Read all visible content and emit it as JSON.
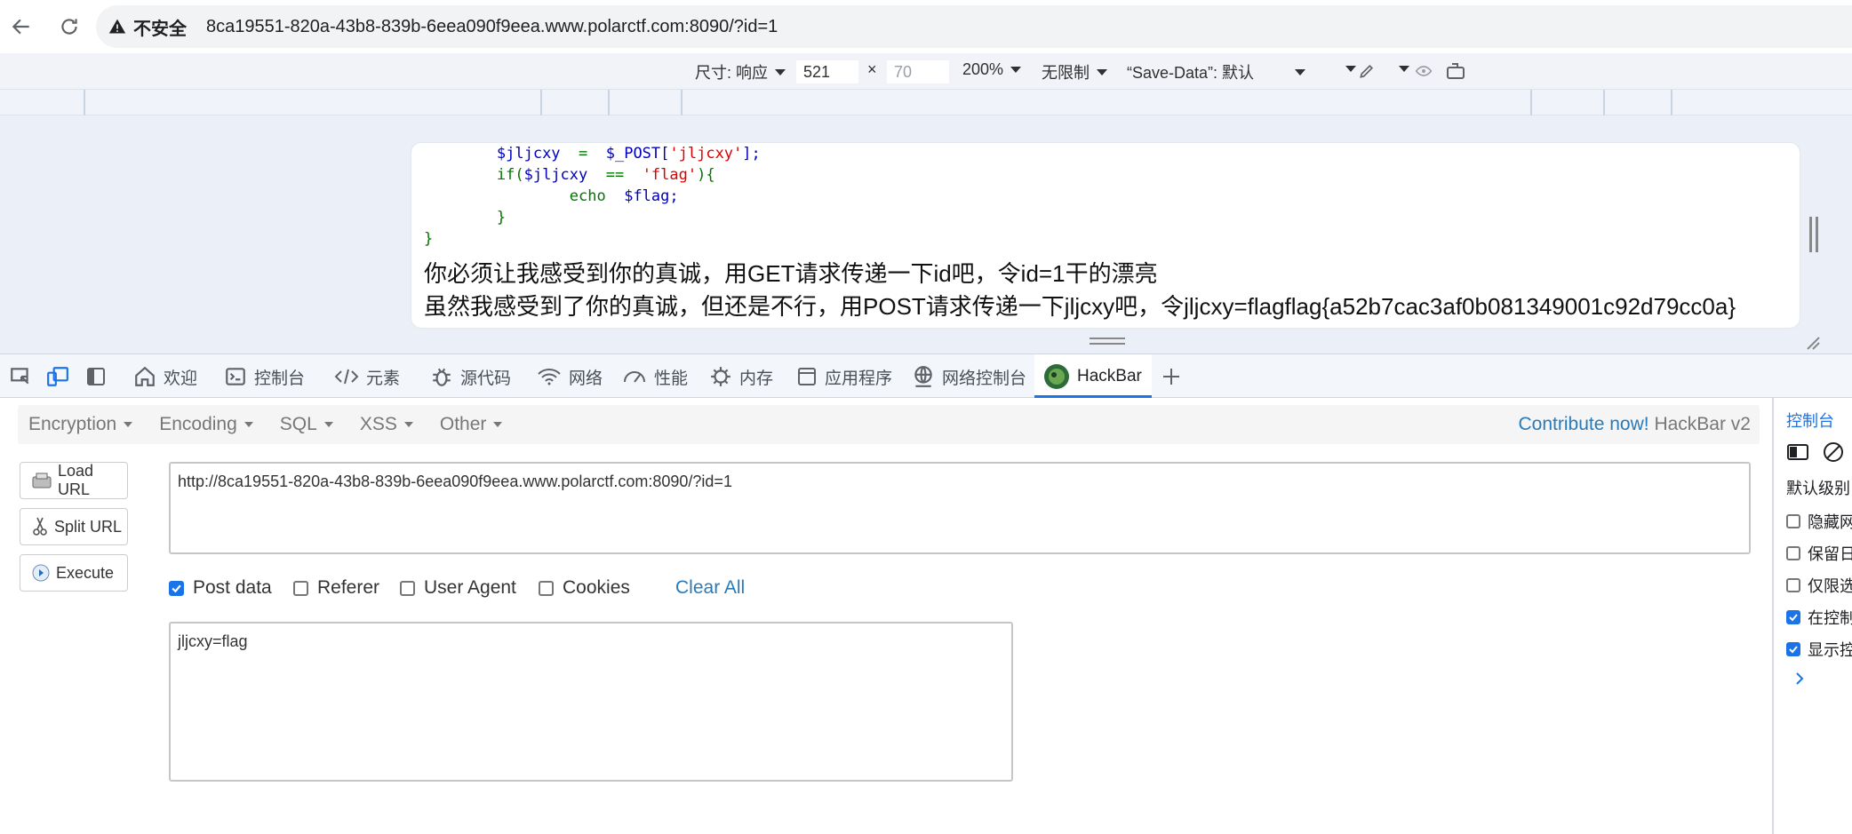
{
  "browser": {
    "security_label": "不安全",
    "url": "8ca19551-820a-43b8-839b-6eea090f9eea.www.polarctf.com:8090/?id=1"
  },
  "device_toolbar": {
    "dimensions_label": "尺寸: 响应",
    "width": "521",
    "times": "×",
    "height": "70",
    "zoom": "200%",
    "throttle": "无限制",
    "save_data": "“Save-Data”: 默认"
  },
  "page": {
    "code_lines": [
      [
        "        ",
        "$jljcxy",
        "  =  ",
        "$_POST[",
        "'jljcxy'",
        "];"
      ],
      [
        "        ",
        "if(",
        "$jljcxy",
        "  ==  ",
        "'flag'",
        "){"
      ],
      [
        "                ",
        "echo",
        "  ",
        "$flag;",
        "",
        ""
      ],
      [
        "        ",
        "}",
        "",
        "",
        "",
        ""
      ],
      [
        "",
        "}",
        "",
        "",
        "",
        ""
      ]
    ],
    "message1": "你必须让我感受到你的真诚，用GET请求传递一下id吧，令id=1干的漂亮",
    "message2": "虽然我感受到了你的真诚，但还是不行，用POST请求传递一下jljcxy吧，令jljcxy=flagflag{a52b7cac3af0b081349001c92d79cc0a}"
  },
  "devtools_tabs": [
    {
      "label": "欢迎"
    },
    {
      "label": "控制台"
    },
    {
      "label": "元素"
    },
    {
      "label": "源代码"
    },
    {
      "label": "网络"
    },
    {
      "label": "性能"
    },
    {
      "label": "内存"
    },
    {
      "label": "应用程序"
    },
    {
      "label": "网络控制台"
    },
    {
      "label": "HackBar"
    }
  ],
  "hackbar": {
    "menus": [
      "Encryption",
      "Encoding",
      "SQL",
      "XSS",
      "Other"
    ],
    "contribute": "Contribute now!",
    "version": "HackBar v2",
    "buttons": {
      "load": "Load URL",
      "split": "Split URL",
      "execute": "Execute"
    },
    "url_value": "http://8ca19551-820a-43b8-839b-6eea090f9eea.www.polarctf.com:8090/?id=1",
    "options": [
      {
        "label": "Post data",
        "checked": true
      },
      {
        "label": "Referer",
        "checked": false
      },
      {
        "label": "User Agent",
        "checked": false
      },
      {
        "label": "Cookies",
        "checked": false
      }
    ],
    "clear_all": "Clear All",
    "post_value": "jljcxy=flag"
  },
  "console_panel": {
    "tab": "控制台",
    "level": "默认级别",
    "options": [
      {
        "label": "隐藏网",
        "checked": false
      },
      {
        "label": "保留日",
        "checked": false
      },
      {
        "label": "仅限选",
        "checked": false
      },
      {
        "label": "在控制",
        "checked": true
      },
      {
        "label": "显示控",
        "checked": true
      }
    ]
  },
  "colors": {
    "accent": "#1a73e8",
    "link": "#2a7ab8",
    "code_var": "#0000bb",
    "code_keyword": "#007700",
    "code_string": "#dd0000"
  }
}
